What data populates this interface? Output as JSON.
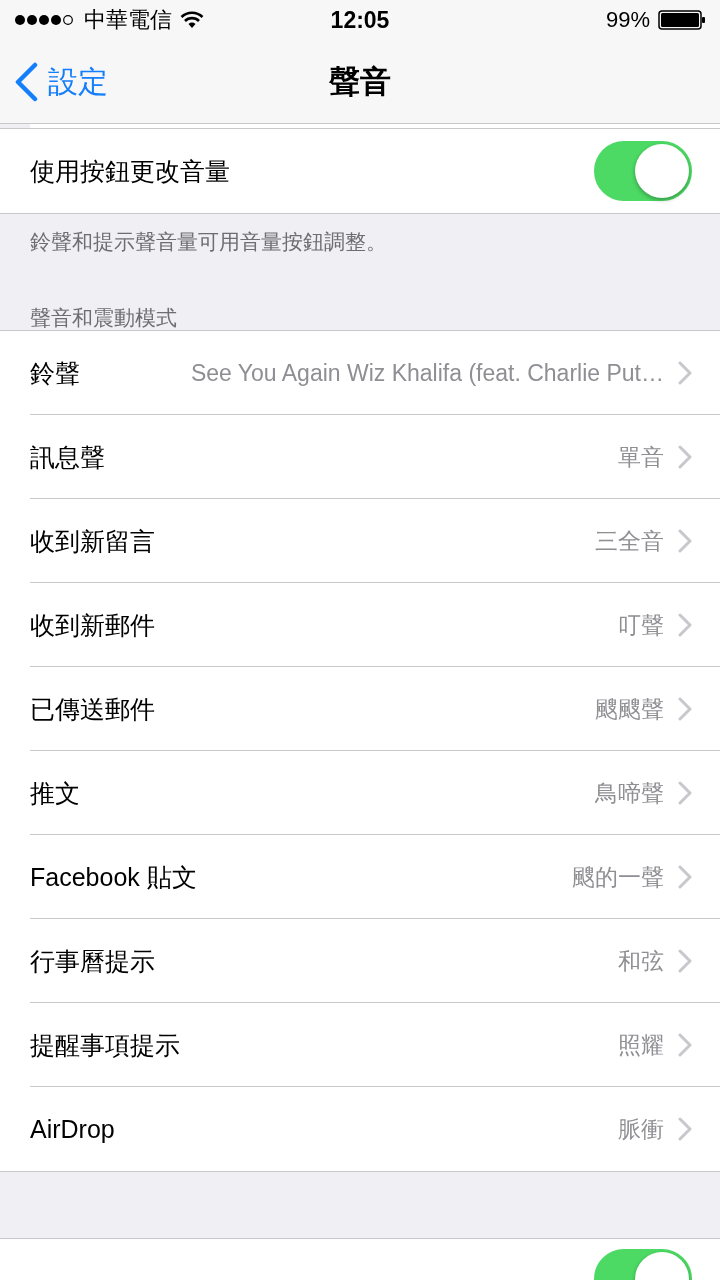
{
  "status_bar": {
    "carrier": "中華電信",
    "time": "12:05",
    "battery": "99%"
  },
  "nav": {
    "back": "設定",
    "title": "聲音"
  },
  "volume_toggle": {
    "label": "使用按鈕更改音量",
    "on": true
  },
  "volume_footer": "鈴聲和提示聲音量可用音量按鈕調整。",
  "section_header": "聲音和震動模式",
  "sounds": [
    {
      "label": "鈴聲",
      "value": "See You Again Wiz Khalifa (feat. Charlie Put…"
    },
    {
      "label": "訊息聲",
      "value": "單音"
    },
    {
      "label": "收到新留言",
      "value": "三全音"
    },
    {
      "label": "收到新郵件",
      "value": "叮聲"
    },
    {
      "label": "已傳送郵件",
      "value": "颼颼聲"
    },
    {
      "label": "推文",
      "value": "鳥啼聲"
    },
    {
      "label": "Facebook 貼文",
      "value": "颼的一聲"
    },
    {
      "label": "行事曆提示",
      "value": "和弦"
    },
    {
      "label": "提醒事項提示",
      "value": "照耀"
    },
    {
      "label": "AirDrop",
      "value": "脈衝"
    }
  ],
  "bottom_toggle": {
    "on": true
  }
}
